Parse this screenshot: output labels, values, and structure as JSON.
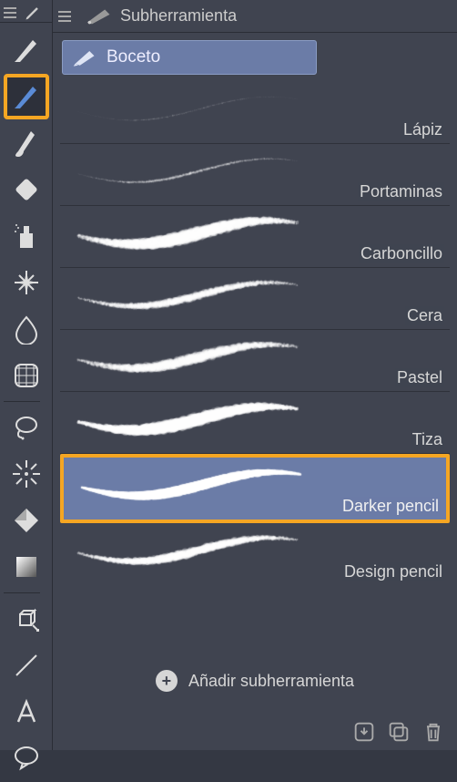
{
  "panel": {
    "title": "Subherramienta"
  },
  "category": {
    "label": "Boceto"
  },
  "brushes": [
    {
      "label": "Lápiz",
      "thickness": 1.5,
      "fuzz": 0.3,
      "opacity": 0.35,
      "selected": false
    },
    {
      "label": "Portaminas",
      "thickness": 2.5,
      "fuzz": 0.4,
      "opacity": 0.5,
      "selected": false
    },
    {
      "label": "Carboncillo",
      "thickness": 7,
      "fuzz": 0.9,
      "opacity": 0.7,
      "selected": false
    },
    {
      "label": "Cera",
      "thickness": 5,
      "fuzz": 0.7,
      "opacity": 0.6,
      "selected": false
    },
    {
      "label": "Pastel",
      "thickness": 6,
      "fuzz": 0.85,
      "opacity": 0.55,
      "selected": false
    },
    {
      "label": "Tiza",
      "thickness": 9,
      "fuzz": 0.5,
      "opacity": 0.85,
      "selected": false
    },
    {
      "label": "Darker pencil",
      "thickness": 10,
      "fuzz": 0.1,
      "opacity": 0.95,
      "selected": true
    },
    {
      "label": "Design pencil",
      "thickness": 6,
      "fuzz": 0.6,
      "opacity": 0.7,
      "selected": false
    }
  ],
  "actions": {
    "add_label": "Añadir subherramienta"
  },
  "toolbar": {
    "tools": [
      "pen",
      "sketch-pen",
      "brush",
      "eraser",
      "airbrush",
      "sparkle",
      "blend",
      "grid",
      "lasso",
      "burst",
      "fill",
      "gradient",
      "cube",
      "line",
      "text",
      "balloon"
    ],
    "highlighted_index": 1,
    "dividers_after": [
      7,
      11
    ]
  }
}
